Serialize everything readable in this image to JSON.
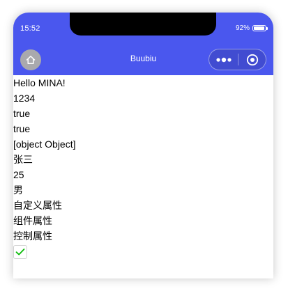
{
  "status_bar": {
    "time": "15:52",
    "battery_percent": "92%",
    "battery_level": 0.92
  },
  "nav": {
    "title": "Buubiu",
    "home_icon": "home-icon",
    "more_icon": "more-dots-icon",
    "close_icon": "close-circle-icon"
  },
  "content": {
    "lines": [
      "Hello MINA!",
      "1234",
      "true",
      "true",
      "[object Object]",
      "张三",
      "25",
      "男",
      "自定义属性",
      "组件属性",
      "控制属性"
    ],
    "checkbox_checked": true
  },
  "colors": {
    "nav_background": "#4a57ee",
    "check_color": "#09bb07"
  }
}
